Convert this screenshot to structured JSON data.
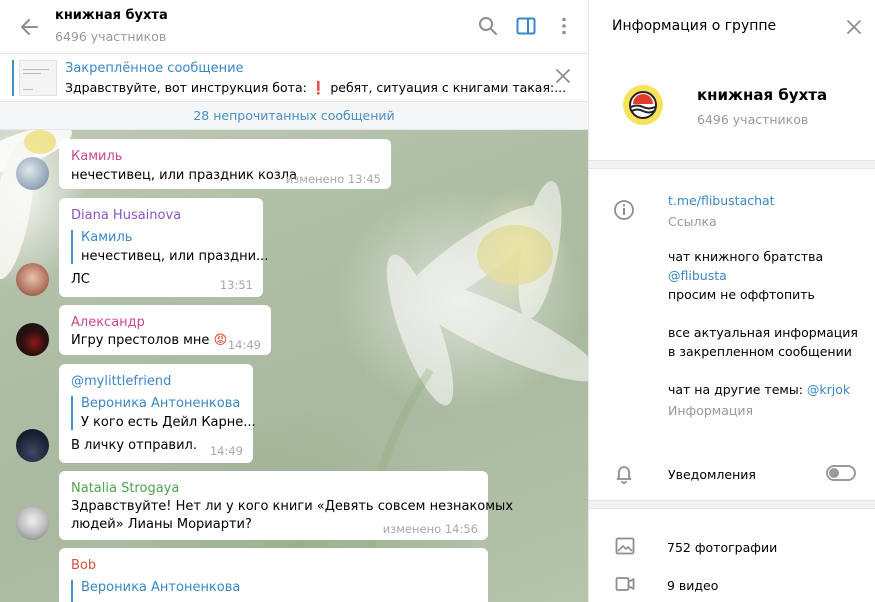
{
  "chat": {
    "title": "книжная бухта",
    "members": "6496 участников",
    "pinned": {
      "title": "Закреплённое сообщение",
      "text": "Здравствуйте, вот инструкция бота: ❗ ребят, ситуация с книгами такая:..."
    },
    "unread_banner": "28 непрочитанных сообщений",
    "messages": [
      {
        "sender": "Камиль",
        "sender_color": "#c94a8c",
        "text": "нечестивец, или праздник козла",
        "time": "изменено 13:45"
      },
      {
        "sender": "Diana Husainova",
        "sender_color": "#8a56c9",
        "reply_name": "Камиль",
        "reply_text": "нечестивец, или праздни...",
        "text": "ЛС",
        "time": "13:51"
      },
      {
        "sender": "Александр",
        "sender_color": "#c94a8c",
        "text": "Игру престолов мне",
        "emoji": "😡",
        "time": "14:49"
      },
      {
        "sender": "@mylittlefriend",
        "sender_color": "#3a87c8",
        "reply_name": "Вероника Антоненкова",
        "reply_text": "У кого есть Дейл Карне...",
        "text": "В личку отправил.",
        "time": "14:49"
      },
      {
        "sender": "Natalia Strogaya",
        "sender_color": "#4fa34f",
        "text": "Здравствуйте! Нет ли у кого книги «Девять совсем незнакомых",
        "text2": "людей» Лианы Мориарти?",
        "time": "изменено 14:56"
      },
      {
        "sender": "Bob",
        "sender_color": "#d0553a",
        "reply_name": "Вероника Антоненкова"
      }
    ]
  },
  "info_panel": {
    "title": "Информация о группе",
    "group_name": "книжная бухта",
    "members": "6496 участников",
    "link": "t.me/flibustachat",
    "link_label": "Ссылка",
    "desc_line1": "чат книжного братства",
    "desc_link1": "@flibusta",
    "desc_line2": "просим не оффтопить",
    "desc_line3": "все актуальная информация",
    "desc_line4": "в закрепленном сообщении",
    "desc_line5_prefix": "чат на другие темы: ",
    "desc_link2": "@krjok",
    "desc_label": "Информация",
    "notifications_label": "Уведомления",
    "notifications_on": false,
    "photos": "752 фотографии",
    "videos": "9 видео"
  }
}
